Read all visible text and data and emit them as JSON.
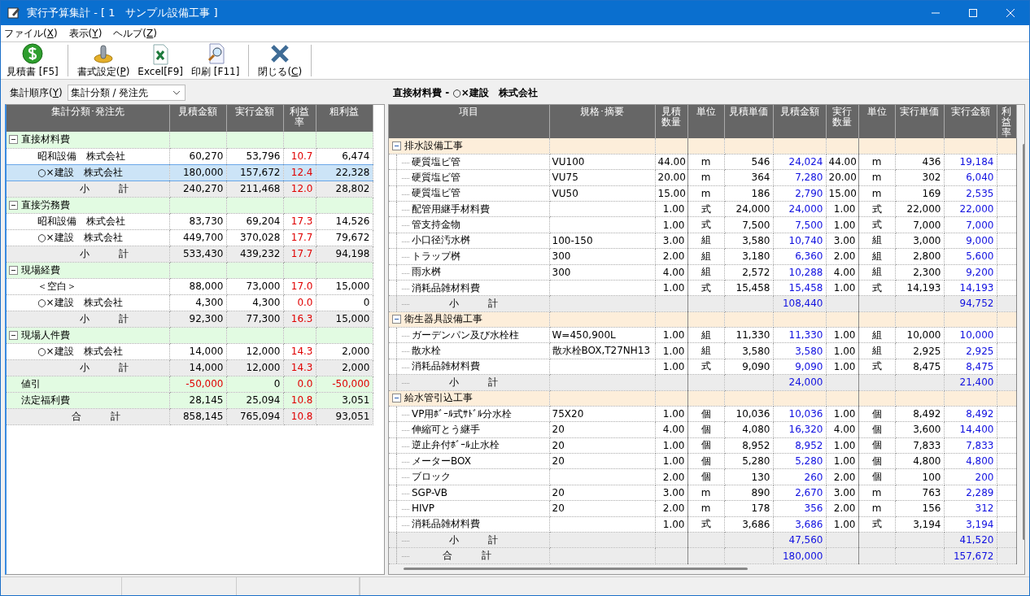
{
  "window": {
    "title": "実行予算集計 - [ 1　サンプル設備工事 ]"
  },
  "menu": [
    {
      "label": "ファイル(",
      "accel": "X",
      "suffix": ")"
    },
    {
      "label": "表示(",
      "accel": "Y",
      "suffix": ")"
    },
    {
      "label": "ヘルプ(",
      "accel": "Z",
      "suffix": ")"
    }
  ],
  "toolbar": [
    [
      {
        "kind": "coin",
        "label": "見積書 [F5]"
      }
    ],
    [
      {
        "kind": "gear",
        "label": "書式設定(",
        "accel": "P",
        "suffix": ")"
      },
      {
        "kind": "excel",
        "label": "Excel[F9]"
      },
      {
        "kind": "print",
        "label": "印刷 [F11]"
      }
    ],
    [
      {
        "kind": "close",
        "label": "閉じる(",
        "accel": "C",
        "suffix": ")"
      }
    ]
  ],
  "order": {
    "label": "集計順序(",
    "accel": "Y",
    "suffix": ")",
    "value": "集計分類 / 発注先"
  },
  "summary": {
    "columns": [
      "集計分類･発注先",
      "見積金額",
      "実行金額",
      "利益率",
      "粗利益"
    ],
    "rows": [
      {
        "kind": "group",
        "expanded": true,
        "selected": false,
        "name": "直接材料費"
      },
      {
        "kind": "item",
        "selected": false,
        "name": "昭和設備　株式会社",
        "estimate": "60,270",
        "actual": "53,796",
        "rate": "10.7",
        "gross": "6,474"
      },
      {
        "kind": "item",
        "selected": true,
        "name": "○×建設　株式会社",
        "estimate": "180,000",
        "actual": "157,672",
        "rate": "12.4",
        "gross": "22,328"
      },
      {
        "kind": "subtotal",
        "selected": false,
        "name": "小　　　計",
        "estimate": "240,270",
        "actual": "211,468",
        "rate": "12.0",
        "gross": "28,802"
      },
      {
        "kind": "group",
        "expanded": true,
        "selected": false,
        "name": "直接労務費"
      },
      {
        "kind": "item",
        "selected": false,
        "name": "昭和設備　株式会社",
        "estimate": "83,730",
        "actual": "69,204",
        "rate": "17.3",
        "gross": "14,526"
      },
      {
        "kind": "item",
        "selected": false,
        "name": "○×建設　株式会社",
        "estimate": "449,700",
        "actual": "370,028",
        "rate": "17.7",
        "gross": "79,672"
      },
      {
        "kind": "subtotal",
        "selected": false,
        "name": "小　　　計",
        "estimate": "533,430",
        "actual": "439,232",
        "rate": "17.7",
        "gross": "94,198"
      },
      {
        "kind": "group",
        "expanded": true,
        "selected": false,
        "name": "現場経費"
      },
      {
        "kind": "item",
        "selected": false,
        "name": "＜空白＞",
        "estimate": "88,000",
        "actual": "73,000",
        "rate": "17.0",
        "gross": "15,000"
      },
      {
        "kind": "item",
        "selected": false,
        "name": "○×建設　株式会社",
        "estimate": "4,300",
        "actual": "4,300",
        "rate": "0.0",
        "gross": "0"
      },
      {
        "kind": "subtotal",
        "selected": false,
        "name": "小　　　計",
        "estimate": "92,300",
        "actual": "77,300",
        "rate": "16.3",
        "gross": "15,000"
      },
      {
        "kind": "group",
        "expanded": true,
        "selected": false,
        "name": "現場人件費"
      },
      {
        "kind": "item",
        "selected": false,
        "name": "○×建設　株式会社",
        "estimate": "14,000",
        "actual": "12,000",
        "rate": "14.3",
        "gross": "2,000"
      },
      {
        "kind": "subtotal",
        "selected": false,
        "name": "小　　　計",
        "estimate": "14,000",
        "actual": "12,000",
        "rate": "14.3",
        "gross": "2,000"
      },
      {
        "kind": "discount",
        "selected": false,
        "name": "値引",
        "estimate": "-50,000",
        "actual": "0",
        "rate": "0.0",
        "gross": "-50,000"
      },
      {
        "kind": "plain",
        "selected": false,
        "name": "法定福利費",
        "estimate": "28,145",
        "actual": "25,094",
        "rate": "10.8",
        "gross": "3,051"
      },
      {
        "kind": "total",
        "selected": false,
        "name": "合　　　計",
        "estimate": "858,145",
        "actual": "765,094",
        "rate": "10.8",
        "gross": "93,051"
      }
    ]
  },
  "detail": {
    "heading": "直接材料費 - ○×建設　株式会社",
    "columns": [
      "項目",
      "規格･摘要",
      "見積数量",
      "単位",
      "見積単価",
      "見積金額",
      "実行数量",
      "単位",
      "実行単価",
      "実行金額",
      "利益率"
    ],
    "rows": [
      {
        "kind": "group",
        "expanded": true,
        "name": "排水設備工事"
      },
      {
        "kind": "item",
        "name": "硬質塩ビ管",
        "spec": "VU100",
        "est_qty": "44.00",
        "est_unit": "m",
        "est_price": "546",
        "est_amount": "24,024",
        "act_qty": "44.00",
        "act_unit": "m",
        "act_price": "436",
        "act_amount": "19,184"
      },
      {
        "kind": "item",
        "name": "硬質塩ビ管",
        "spec": "VU75",
        "est_qty": "20.00",
        "est_unit": "m",
        "est_price": "364",
        "est_amount": "7,280",
        "act_qty": "20.00",
        "act_unit": "m",
        "act_price": "302",
        "act_amount": "6,040"
      },
      {
        "kind": "item",
        "name": "硬質塩ビ管",
        "spec": "VU50",
        "est_qty": "15.00",
        "est_unit": "m",
        "est_price": "186",
        "est_amount": "2,790",
        "act_qty": "15.00",
        "act_unit": "m",
        "act_price": "169",
        "act_amount": "2,535"
      },
      {
        "kind": "item",
        "name": "配管用継手材料費",
        "est_qty": "1.00",
        "est_unit": "式",
        "est_price": "24,000",
        "est_amount": "24,000",
        "act_qty": "1.00",
        "act_unit": "式",
        "act_price": "22,000",
        "act_amount": "22,000"
      },
      {
        "kind": "item",
        "name": "管支持金物",
        "est_qty": "1.00",
        "est_unit": "式",
        "est_price": "7,500",
        "est_amount": "7,500",
        "act_qty": "1.00",
        "act_unit": "式",
        "act_price": "7,000",
        "act_amount": "7,000"
      },
      {
        "kind": "item",
        "name": "小口径汚水桝",
        "spec": "100-150",
        "est_qty": "3.00",
        "est_unit": "組",
        "est_price": "3,580",
        "est_amount": "10,740",
        "act_qty": "3.00",
        "act_unit": "組",
        "act_price": "3,000",
        "act_amount": "9,000"
      },
      {
        "kind": "item",
        "name": "トラップ桝",
        "spec": "300",
        "est_qty": "2.00",
        "est_unit": "組",
        "est_price": "3,180",
        "est_amount": "6,360",
        "act_qty": "2.00",
        "act_unit": "組",
        "act_price": "2,800",
        "act_amount": "5,600"
      },
      {
        "kind": "item",
        "name": "雨水桝",
        "spec": "300",
        "est_qty": "4.00",
        "est_unit": "組",
        "est_price": "2,572",
        "est_amount": "10,288",
        "act_qty": "4.00",
        "act_unit": "組",
        "act_price": "2,300",
        "act_amount": "9,200"
      },
      {
        "kind": "item",
        "name": "消耗品雑材料費",
        "est_qty": "1.00",
        "est_unit": "式",
        "est_price": "15,458",
        "est_amount": "15,458",
        "act_qty": "1.00",
        "act_unit": "式",
        "act_price": "14,193",
        "act_amount": "14,193"
      },
      {
        "kind": "subtotal",
        "name": "小　　　計",
        "est_amount": "108,440",
        "act_amount": "94,752"
      },
      {
        "kind": "group",
        "expanded": true,
        "name": "衛生器具設備工事"
      },
      {
        "kind": "item",
        "name": "ガーデンパン及び水栓柱",
        "spec": "W=450,900L",
        "est_qty": "1.00",
        "est_unit": "組",
        "est_price": "11,330",
        "est_amount": "11,330",
        "act_qty": "1.00",
        "act_unit": "組",
        "act_price": "10,000",
        "act_amount": "10,000"
      },
      {
        "kind": "item",
        "name": "散水栓",
        "spec": "散水栓BOX,T27NH13",
        "est_qty": "1.00",
        "est_unit": "組",
        "est_price": "3,580",
        "est_amount": "3,580",
        "act_qty": "1.00",
        "act_unit": "組",
        "act_price": "2,925",
        "act_amount": "2,925"
      },
      {
        "kind": "item",
        "name": "消耗品雑材料費",
        "est_qty": "1.00",
        "est_unit": "式",
        "est_price": "9,090",
        "est_amount": "9,090",
        "act_qty": "1.00",
        "act_unit": "式",
        "act_price": "8,475",
        "act_amount": "8,475"
      },
      {
        "kind": "subtotal",
        "name": "小　　　計",
        "est_amount": "24,000",
        "act_amount": "21,400"
      },
      {
        "kind": "group",
        "expanded": true,
        "name": "給水管引込工事"
      },
      {
        "kind": "item",
        "name": "VP用ﾎﾞｰﾙ式ｻﾄﾞﾙ分水栓",
        "spec": "75X20",
        "est_qty": "1.00",
        "est_unit": "個",
        "est_price": "10,036",
        "est_amount": "10,036",
        "act_qty": "1.00",
        "act_unit": "個",
        "act_price": "8,492",
        "act_amount": "8,492"
      },
      {
        "kind": "item",
        "name": "伸縮可とう継手",
        "spec": "20",
        "est_qty": "4.00",
        "est_unit": "個",
        "est_price": "4,080",
        "est_amount": "16,320",
        "act_qty": "4.00",
        "act_unit": "個",
        "act_price": "3,600",
        "act_amount": "14,400"
      },
      {
        "kind": "item",
        "name": "逆止弁付ﾎﾞｰﾙ止水栓",
        "spec": "20",
        "est_qty": "1.00",
        "est_unit": "個",
        "est_price": "8,952",
        "est_amount": "8,952",
        "act_qty": "1.00",
        "act_unit": "個",
        "act_price": "7,833",
        "act_amount": "7,833"
      },
      {
        "kind": "item",
        "name": "メーターBOX",
        "spec": "20",
        "est_qty": "1.00",
        "est_unit": "個",
        "est_price": "5,280",
        "est_amount": "5,280",
        "act_qty": "1.00",
        "act_unit": "個",
        "act_price": "4,800",
        "act_amount": "4,800"
      },
      {
        "kind": "item",
        "name": "ブロック",
        "est_qty": "2.00",
        "est_unit": "個",
        "est_price": "130",
        "est_amount": "260",
        "act_qty": "2.00",
        "act_unit": "個",
        "act_price": "100",
        "act_amount": "200"
      },
      {
        "kind": "item",
        "name": "SGP-VB",
        "spec": "20",
        "est_qty": "3.00",
        "est_unit": "m",
        "est_price": "890",
        "est_amount": "2,670",
        "act_qty": "3.00",
        "act_unit": "m",
        "act_price": "763",
        "act_amount": "2,289"
      },
      {
        "kind": "item",
        "name": "HIVP",
        "spec": "20",
        "est_qty": "2.00",
        "est_unit": "m",
        "est_price": "178",
        "est_amount": "356",
        "act_qty": "2.00",
        "act_unit": "m",
        "act_price": "156",
        "act_amount": "312"
      },
      {
        "kind": "item",
        "name": "消耗品雑材料費",
        "est_qty": "1.00",
        "est_unit": "式",
        "est_price": "3,686",
        "est_amount": "3,686",
        "act_qty": "1.00",
        "act_unit": "式",
        "act_price": "3,194",
        "act_amount": "3,194"
      },
      {
        "kind": "subtotal",
        "name": "小　　　計",
        "est_amount": "47,560",
        "act_amount": "41,520"
      },
      {
        "kind": "total",
        "name": "合　　　計",
        "est_amount": "180,000",
        "act_amount": "157,672"
      }
    ]
  }
}
